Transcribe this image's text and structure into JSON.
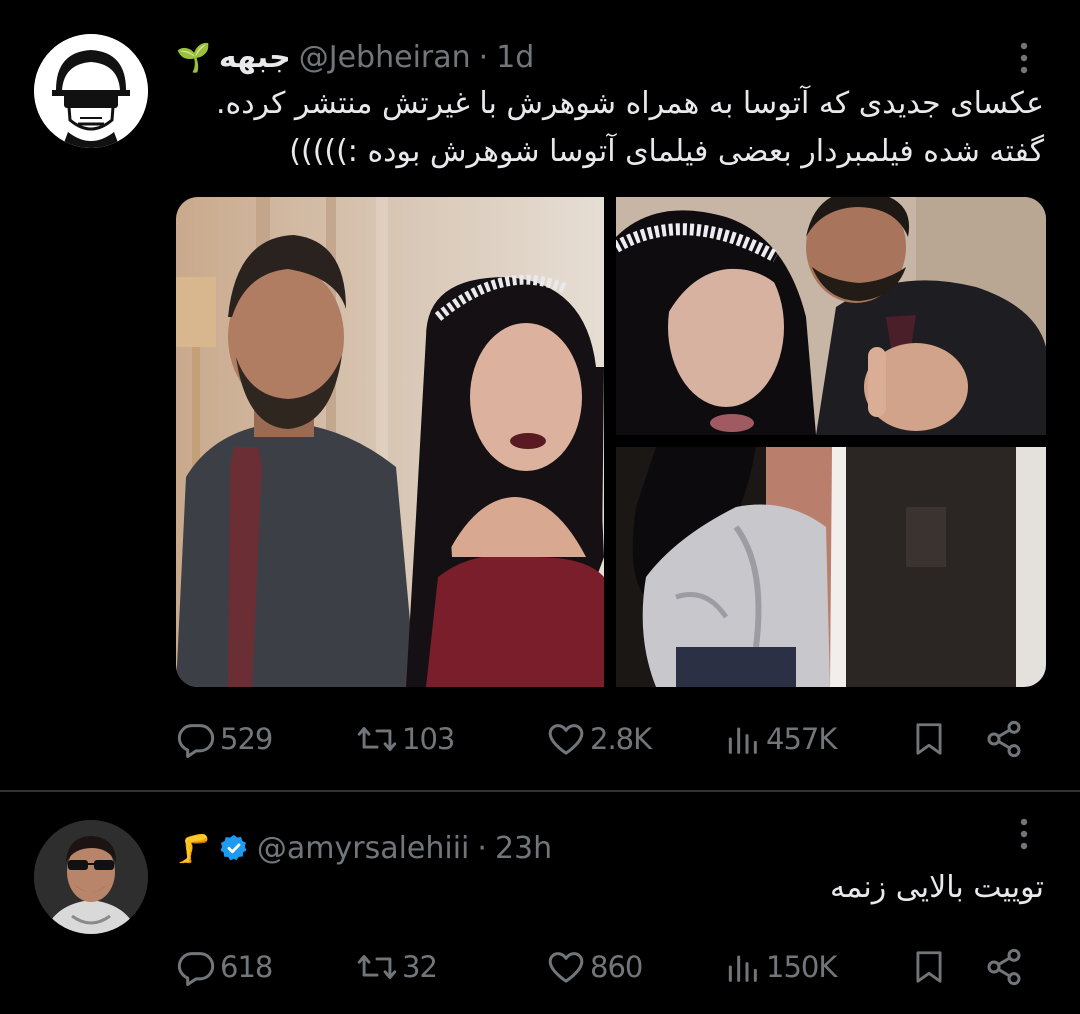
{
  "tweets": [
    {
      "display_name": "جبهه",
      "name_emoji": "🌱",
      "handle": "@Jebheiran",
      "time": "1d",
      "text_lines": [
        "عکسای جدیدی که آتوسا به همراه شوهرش با غیرتش منتشر کرده.",
        "گفته شده فیلمبردار بعضی فیلمای آتوسا شوهرش بوده :)))))"
      ],
      "replies": "529",
      "retweets": "103",
      "likes": "2.8K",
      "views": "457K"
    },
    {
      "name_emoji": "🦵",
      "handle": "@amyrsalehiii",
      "time": "23h",
      "text_lines": [
        "توییت بالایی زنمه"
      ],
      "replies": "618",
      "retweets": "32",
      "likes": "860",
      "views": "150K"
    }
  ],
  "separator": "·",
  "colors": {
    "background": "#000000",
    "text": "#e7e9ea",
    "secondary": "#71767b",
    "verified": "#1d9bf0",
    "divider": "#2f3336"
  }
}
